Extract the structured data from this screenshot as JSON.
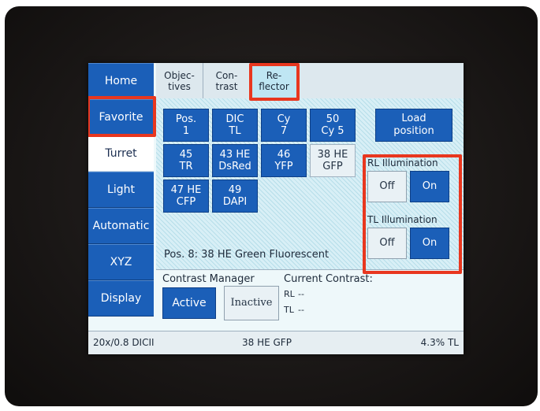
{
  "sidebar": {
    "items": [
      {
        "label": "Home"
      },
      {
        "label": "Favorite"
      },
      {
        "label": "Turret"
      },
      {
        "label": "Light"
      },
      {
        "label": "Automatic"
      },
      {
        "label": "XYZ"
      },
      {
        "label": "Display"
      }
    ],
    "active": "Turret"
  },
  "tabs": [
    {
      "label": "Objec-\ntives"
    },
    {
      "label": "Con-\ntrast"
    },
    {
      "label": "Re-\nflector"
    }
  ],
  "reflector_positions": [
    {
      "label": "Pos.\n1"
    },
    {
      "label": "DIC\nTL"
    },
    {
      "label": "Cy\n7"
    },
    {
      "label": "50\nCy 5"
    },
    {
      "label": "45\nTR"
    },
    {
      "label": "43 HE\nDsRed"
    },
    {
      "label": "46\nYFP"
    },
    {
      "label": "38 HE\nGFP"
    },
    {
      "label": "47 HE\nCFP"
    },
    {
      "label": "49\nDAPI"
    }
  ],
  "load_position_label": "Load\nposition",
  "rl_illumination": {
    "title": "RL Illumination",
    "off": "Off",
    "on": "On"
  },
  "tl_illumination": {
    "title": "TL Illumination",
    "off": "Off",
    "on": "On"
  },
  "position_info": "Pos. 8: 38 HE Green Fluorescent",
  "contrast_manager": {
    "title": "Contrast Manager",
    "active": "Active",
    "inactive": "Inactive"
  },
  "current_contrast": {
    "title": "Current Contrast:",
    "rl_label": "RL",
    "rl_value": "--",
    "tl_label": "TL",
    "tl_value": "--"
  },
  "status_bar": {
    "objective": "20x/0.8 DICII",
    "reflector": "38 HE GFP",
    "tl_level": "4.3% TL"
  },
  "colors": {
    "button_blue": "#1b5fb8",
    "highlight_red": "#e8371f",
    "screen_bg": "#eef8fa"
  }
}
